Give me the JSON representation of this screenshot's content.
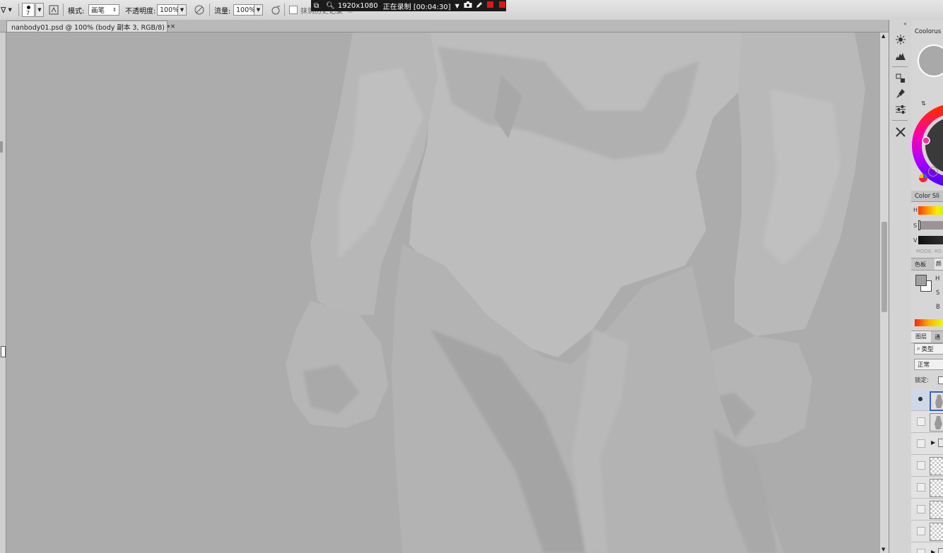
{
  "options_bar": {
    "brush_size": "7",
    "mode_label": "模式:",
    "mode_value": "画笔",
    "opacity_label": "不透明度:",
    "opacity_value": "100%",
    "flow_label": "流量:",
    "flow_value": "100%",
    "erase_label": "抹到历史记录"
  },
  "recorder": {
    "resolution": "1920x1080",
    "status": "正在录制 [00:04:30]",
    "colors": {
      "bar": "#1b1b1b",
      "stop": "#e01515"
    }
  },
  "document_tab": {
    "title": "nanbody01.psd @ 100% (body 副本 3, RGB/8) *",
    "close": "×"
  },
  "panels": {
    "coolorus_title": "Coolorus",
    "color_slider_title": "Color Sli",
    "slider_labels": [
      "H",
      "S",
      "V"
    ],
    "mode_label": "MODE: RG",
    "color_tabs": [
      "色板",
      "颜"
    ],
    "hsb_labels": [
      "H",
      "S",
      "B"
    ],
    "layer_tabs": [
      "图层",
      "通"
    ],
    "layer_filter": "类型",
    "blend_mode": "正常",
    "lock_label": "锁定:",
    "layers": [
      {
        "visible": true,
        "kind": "figure"
      },
      {
        "visible": false,
        "kind": "figure"
      },
      {
        "visible": false,
        "kind": "group"
      },
      {
        "visible": false,
        "kind": "empty"
      },
      {
        "visible": false,
        "kind": "empty"
      },
      {
        "visible": false,
        "kind": "empty"
      },
      {
        "visible": false,
        "kind": "empty"
      },
      {
        "visible": false,
        "kind": "group"
      }
    ]
  },
  "dock_icons": [
    "brightness-icon",
    "histogram-icon",
    "clone-source-icon",
    "brush-preset-icon",
    "adjust-icon",
    "tools-icon"
  ]
}
